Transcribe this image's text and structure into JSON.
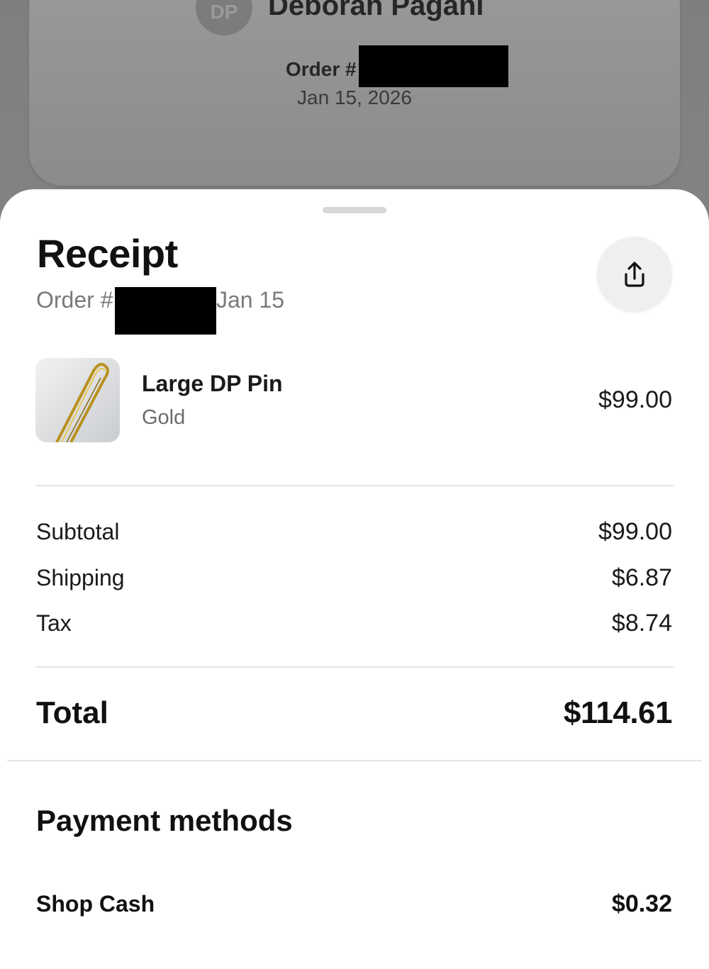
{
  "background": {
    "avatar_initials": "DP",
    "store_name": "Deborah Pagani",
    "order_label": "Order #",
    "order_date": "Jan 15, 2026"
  },
  "receipt": {
    "title": "Receipt",
    "order_label": "Order #",
    "order_date": "Jan 15",
    "share_icon": "share-upload-icon"
  },
  "item": {
    "name": "Large DP Pin",
    "variant": "Gold",
    "price": "$99.00"
  },
  "summary": {
    "subtotal_label": "Subtotal",
    "subtotal_value": "$99.00",
    "shipping_label": "Shipping",
    "shipping_value": "$6.87",
    "tax_label": "Tax",
    "tax_value": "$8.74",
    "total_label": "Total",
    "total_value": "$114.61"
  },
  "payment": {
    "title": "Payment methods",
    "method_label": "Shop Cash",
    "method_value": "$0.32"
  }
}
